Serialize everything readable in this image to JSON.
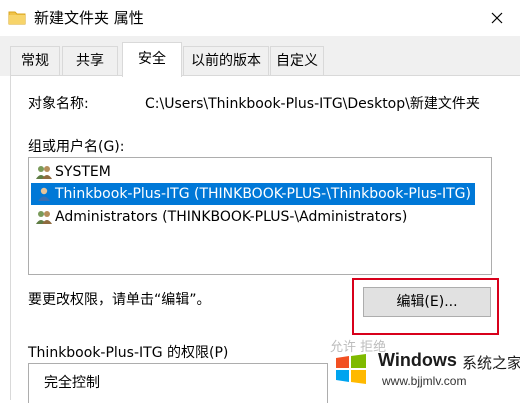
{
  "window": {
    "title": "新建文件夹 属性",
    "close_icon": "close-icon"
  },
  "tabs": [
    {
      "label": "常规",
      "active": false
    },
    {
      "label": "共享",
      "active": false
    },
    {
      "label": "安全",
      "active": true
    },
    {
      "label": "以前的版本",
      "active": false
    },
    {
      "label": "自定义",
      "active": false
    }
  ],
  "security": {
    "object_name_label": "对象名称:",
    "object_name_value": "C:\\Users\\Thinkbook-Plus-ITG\\Desktop\\新建文件夹",
    "group_label": "组或用户名(G):",
    "users": [
      {
        "name": "SYSTEM",
        "icon": "user-group-icon",
        "selected": false
      },
      {
        "name": "Thinkbook-Plus-ITG (THINKBOOK-PLUS-\\Thinkbook-Plus-ITG)",
        "icon": "user-icon",
        "selected": true
      },
      {
        "name": "Administrators (THINKBOOK-PLUS-\\Administrators)",
        "icon": "user-group-icon",
        "selected": false
      }
    ],
    "change_hint": "要更改权限，请单击“编辑”。",
    "edit_button": "编辑(E)...",
    "permissions_label": "Thinkbook-Plus-ITG 的权限(P)",
    "permissions": [
      "完全控制"
    ]
  },
  "watermark": {
    "brand": "Windows",
    "brand_cn": "系统之家",
    "url": "www.bjjmlv.com",
    "faint_text": "允许          拒绝"
  },
  "colors": {
    "selection": "#0078d7",
    "highlight_box": "#d8001b"
  }
}
